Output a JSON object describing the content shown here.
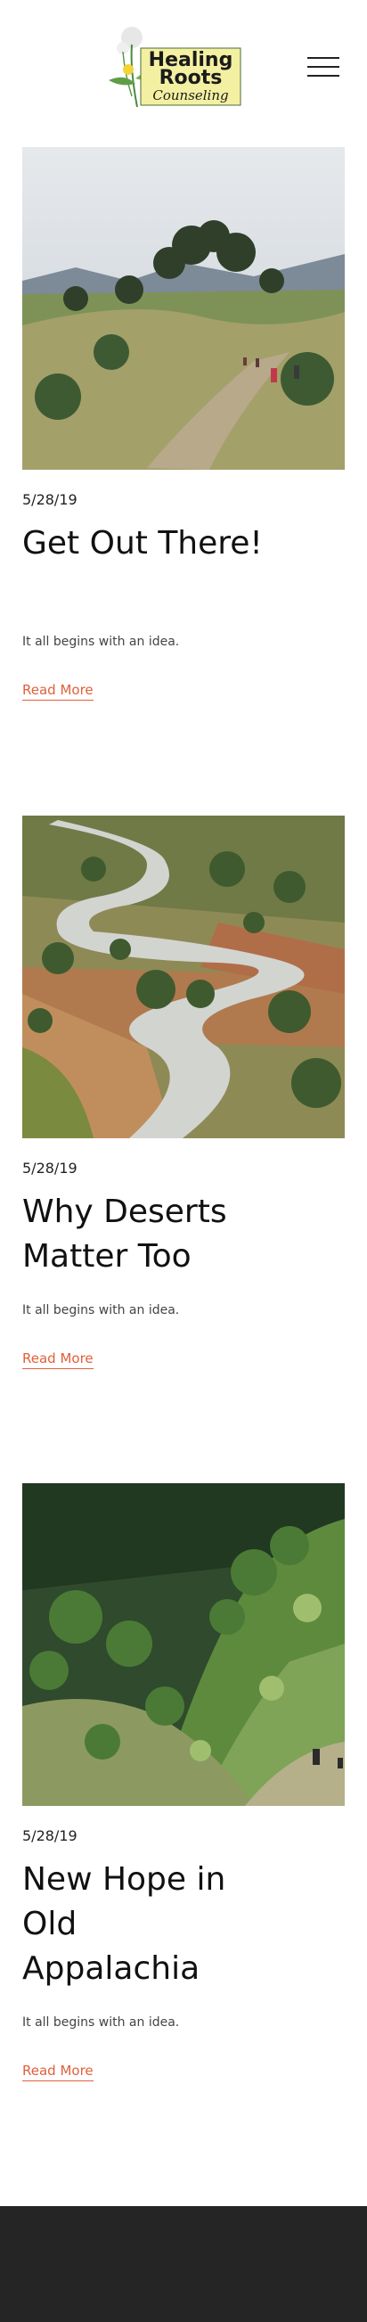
{
  "site": {
    "logo_line1": "Healing",
    "logo_line2": "Roots",
    "logo_line3": "Counseling"
  },
  "header": {
    "menu_icon": "hamburger-menu-icon"
  },
  "posts": [
    {
      "date": "5/28/19",
      "title": "Get Out There!",
      "excerpt": "It all begins with an idea.",
      "read_more": "Read More",
      "image": "hikers-on-grassy-trail-photo"
    },
    {
      "date": "5/28/19",
      "title": "Why Deserts Matter Too",
      "excerpt": "It all begins with an idea.",
      "read_more": "Read More",
      "image": "winding-road-through-hills-photo"
    },
    {
      "date": "5/28/19",
      "title": "New Hope in Old Appalachia",
      "excerpt": "It all begins with an idea.",
      "read_more": "Read More",
      "image": "overgrown-green-hillside-photo"
    }
  ],
  "colors": {
    "accent": "#e0603b",
    "footer": "#252525",
    "text": "#111111"
  }
}
